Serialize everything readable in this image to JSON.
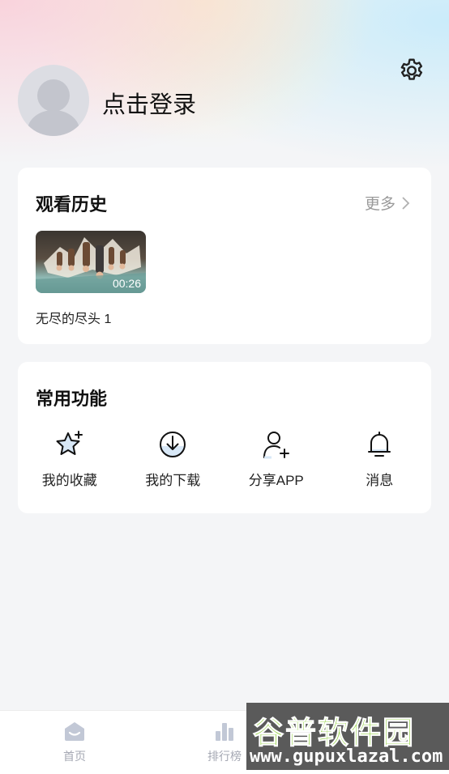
{
  "profile": {
    "login_text": "点击登录"
  },
  "icons": {
    "settings": "gear-icon",
    "more_arrow": "chevron-right-icon",
    "favorites": "star-plus-icon",
    "downloads": "download-icon",
    "share": "add-user-icon",
    "messages": "bell-icon",
    "home": "home-icon",
    "ranking": "bar-chart-icon"
  },
  "history": {
    "title": "观看历史",
    "more_label": "更多",
    "items": [
      {
        "title": "无尽的尽头 1",
        "duration": "00:26"
      }
    ]
  },
  "functions": {
    "title": "常用功能",
    "items": [
      {
        "label": "我的收藏"
      },
      {
        "label": "我的下载"
      },
      {
        "label": "分享APP"
      },
      {
        "label": "消息"
      }
    ]
  },
  "tabbar": {
    "tabs": [
      {
        "label": "首页"
      },
      {
        "label": "排行榜"
      }
    ]
  },
  "watermark": {
    "line1": "谷普软件园",
    "line2": "www.gupuxlazal.com"
  },
  "colors": {
    "background": "#f4f5f7",
    "card": "#ffffff",
    "tab_inactive": "#a5a8b3",
    "watermark_green": "#8fcf3b"
  }
}
